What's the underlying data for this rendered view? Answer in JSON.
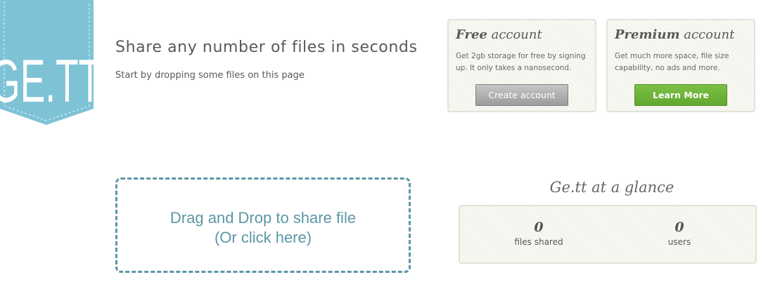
{
  "brand": {
    "logo_text": "GE.TT",
    "ribbon_color": "#7ec2d6"
  },
  "header": {
    "headline": "Share any number of files in seconds",
    "subline": "Start by dropping some files on this page"
  },
  "cards": {
    "free": {
      "title_bold": "Free",
      "title_rest": " account",
      "description": "Get 2gb storage for free by signing up. It only takes a nanosecond.",
      "button_label": "Create account"
    },
    "premium": {
      "title_bold": "Premium",
      "title_rest": " account",
      "description": "Get much more space, file size capability, no ads and more.",
      "button_label": "Learn More",
      "button_color": "#6bb33a"
    }
  },
  "dropzone": {
    "line1": "Drag and Drop to share file",
    "line2": "(Or click here)",
    "color": "#5b97a6"
  },
  "glance": {
    "title": "Ge.tt at a glance",
    "stats": [
      {
        "value": "0",
        "label": "files shared"
      },
      {
        "value": "0",
        "label": "users"
      }
    ]
  }
}
